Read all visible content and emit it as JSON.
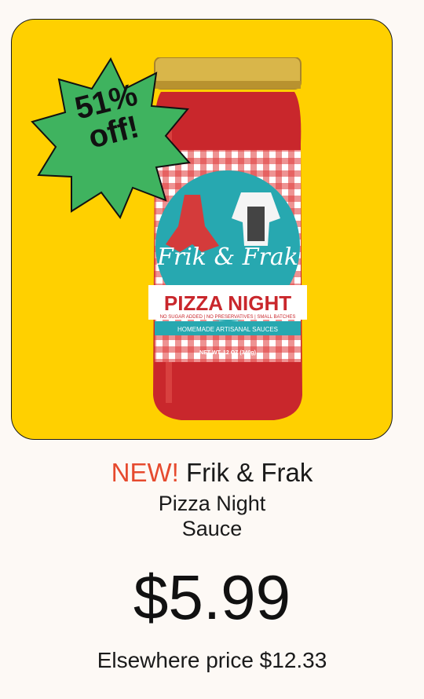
{
  "colors": {
    "page_background": "#fdf9f5",
    "card_background": "#ffd000",
    "badge_green": "#3fb35f",
    "new_label": "#e64a2e",
    "jar_lid": "#d9b64a",
    "sauce_red": "#c9272c",
    "label_teal": "#27a8b0"
  },
  "badge": {
    "line1": "51%",
    "line2": "off!"
  },
  "product": {
    "new_label": "NEW!",
    "brand": "Frik & Frak",
    "name_line1": "Pizza Night",
    "name_line2": "Sauce",
    "price": "$5.99",
    "elsewhere_label": "Elsewhere price",
    "elsewhere_price": "$12.33",
    "image_icon": "sauce-jar-image",
    "jar_label": {
      "brand_script": "Frik & Frak",
      "title": "PIZZA NIGHT",
      "claims": "NO SUGAR ADDED | NO PRESERVATIVES | SMALL BATCHES",
      "tagline": "HOMEMADE ARTISANAL SAUCES",
      "net_wt": "NET WT. 12 OZ (340g)"
    }
  }
}
